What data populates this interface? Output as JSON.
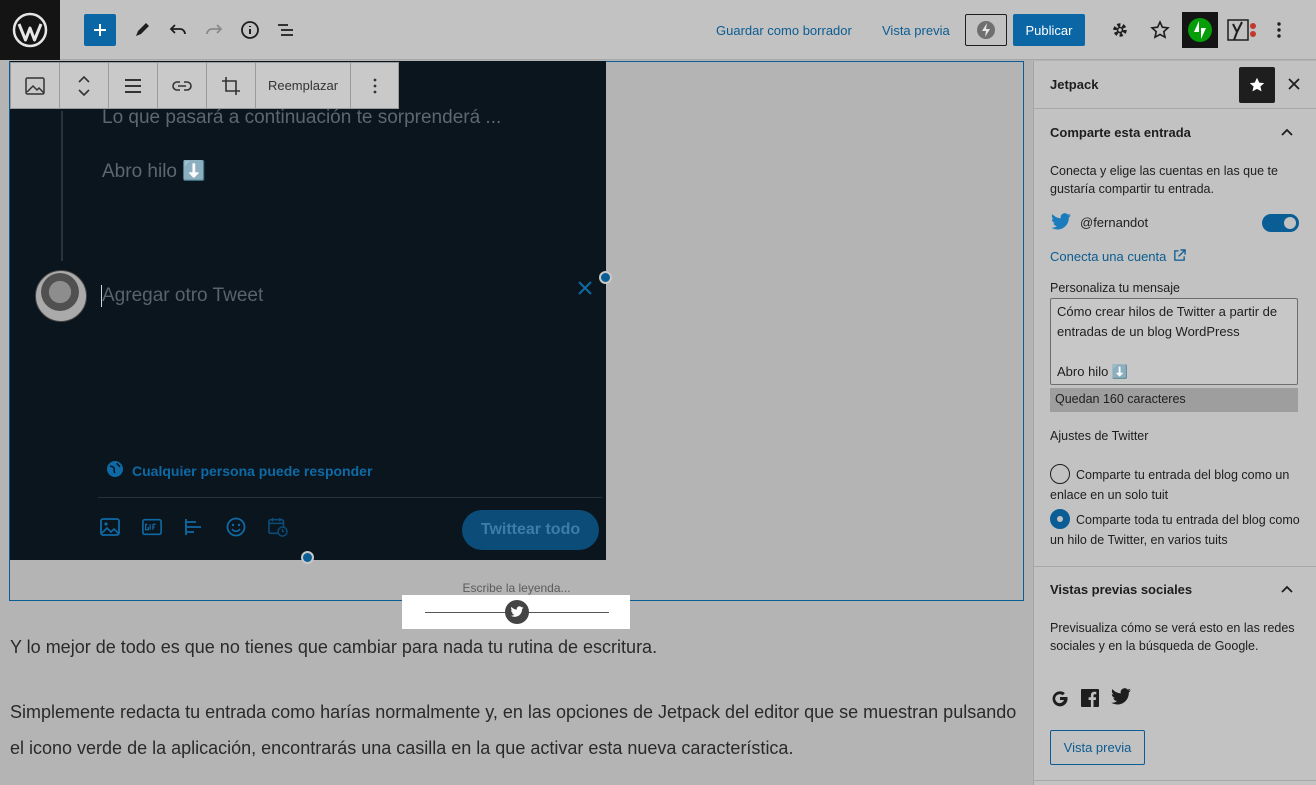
{
  "toolbar": {
    "save_draft": "Guardar como borrador",
    "preview": "Vista previa",
    "publish": "Publicar"
  },
  "block_toolbar": {
    "replace": "Reemplazar"
  },
  "tweet": {
    "line1": "Lo que pasará a continuación te sorprenderá ...",
    "line2": "Abro hilo ⬇️",
    "placeholder": "Agregar otro Tweet",
    "reply_setting": "Cualquier persona puede responder",
    "tweet_all": "Twittear todo"
  },
  "caption_placeholder": "Escribe la leyenda...",
  "content": {
    "para1": "Y lo mejor de todo es que no tienes que cambiar para nada tu rutina de escritura.",
    "para2": "Simplemente redacta tu entrada como harías normalmente y, en las opciones de Jetpack del editor que se muestran pulsando el icono verde de la aplicación, encontrarás una casilla en la que activar esta nueva característica."
  },
  "sidebar": {
    "title": "Jetpack",
    "share": {
      "title": "Comparte esta entrada",
      "description": "Conecta y elige las cuentas en las que te gustaría compartir tu entrada.",
      "account": "@fernandot",
      "account_enabled": true,
      "connect_link": "Conecta una cuenta",
      "customize_label": "Personaliza tu mensaje",
      "message": "Cómo crear hilos de Twitter a partir de entradas de un blog WordPress\n\nAbro hilo ⬇️",
      "remaining": "Quedan 160 caracteres",
      "twitter_settings_label": "Ajustes de Twitter",
      "option_single": "Comparte tu entrada del blog como un enlace en un solo tuit",
      "option_thread": "Comparte toda tu entrada del blog como un hilo de Twitter, en varios tuits",
      "selected_option": "thread"
    },
    "social_previews": {
      "title": "Vistas previas sociales",
      "description": "Previsualiza cómo se verá esto en las redes sociales y en la búsqueda de Google.",
      "button": "Vista previa"
    }
  },
  "colors": {
    "accent": "#0a66a5",
    "jetpack_green": "#069e08",
    "twitter_blue": "#1d9bf0"
  }
}
